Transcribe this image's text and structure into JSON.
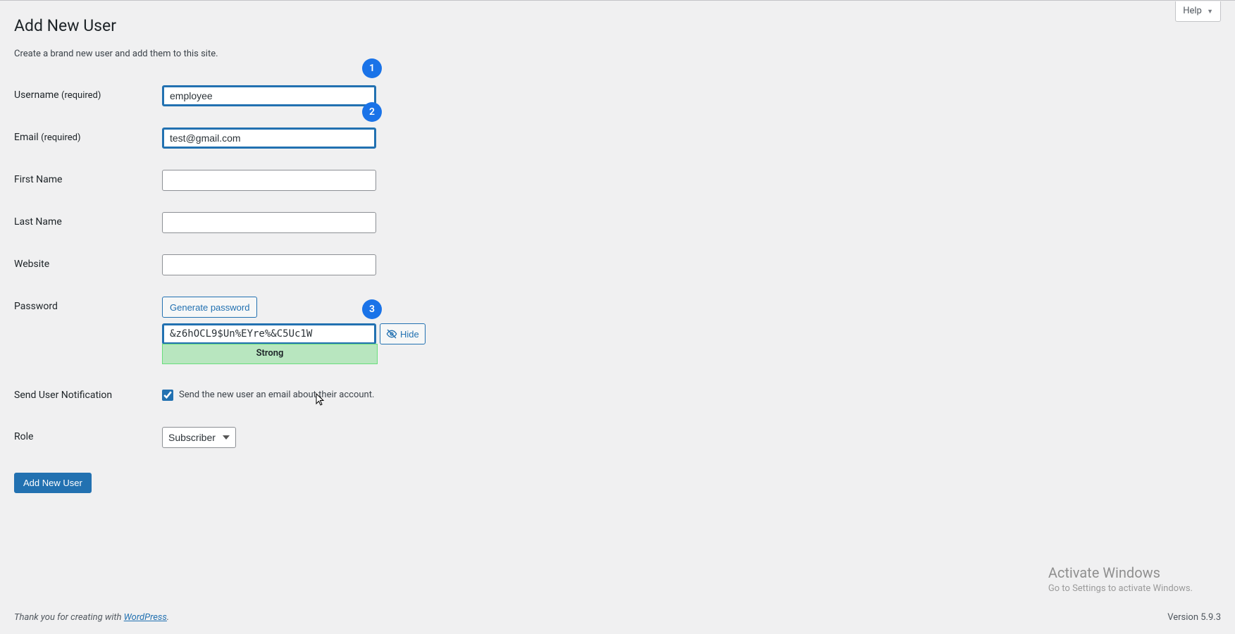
{
  "helpLabel": "Help",
  "pageTitle": "Add New User",
  "description": "Create a brand new user and add them to this site.",
  "annotations": {
    "a1": "1",
    "a2": "2",
    "a3": "3"
  },
  "form": {
    "username": {
      "label": "Username",
      "req": "(required)",
      "value": "employee"
    },
    "email": {
      "label": "Email",
      "req": "(required)",
      "value": "test@gmail.com"
    },
    "firstName": {
      "label": "First Name",
      "value": ""
    },
    "lastName": {
      "label": "Last Name",
      "value": ""
    },
    "website": {
      "label": "Website",
      "value": ""
    },
    "password": {
      "label": "Password",
      "generateBtn": "Generate password",
      "value": "&z6hOCL9$Un%EYre%&C5Uc1W",
      "hideBtn": "Hide",
      "strength": "Strong"
    },
    "notification": {
      "label": "Send User Notification",
      "checkboxLabel": "Send the new user an email about their account.",
      "checked": true
    },
    "role": {
      "label": "Role",
      "selected": "Subscriber"
    },
    "submit": "Add New User"
  },
  "footer": {
    "thankText": "Thank you for creating with ",
    "wpLink": "WordPress",
    "period": ".",
    "version": "Version 5.9.3"
  },
  "watermark": {
    "title": "Activate Windows",
    "subtitle": "Go to Settings to activate Windows."
  }
}
